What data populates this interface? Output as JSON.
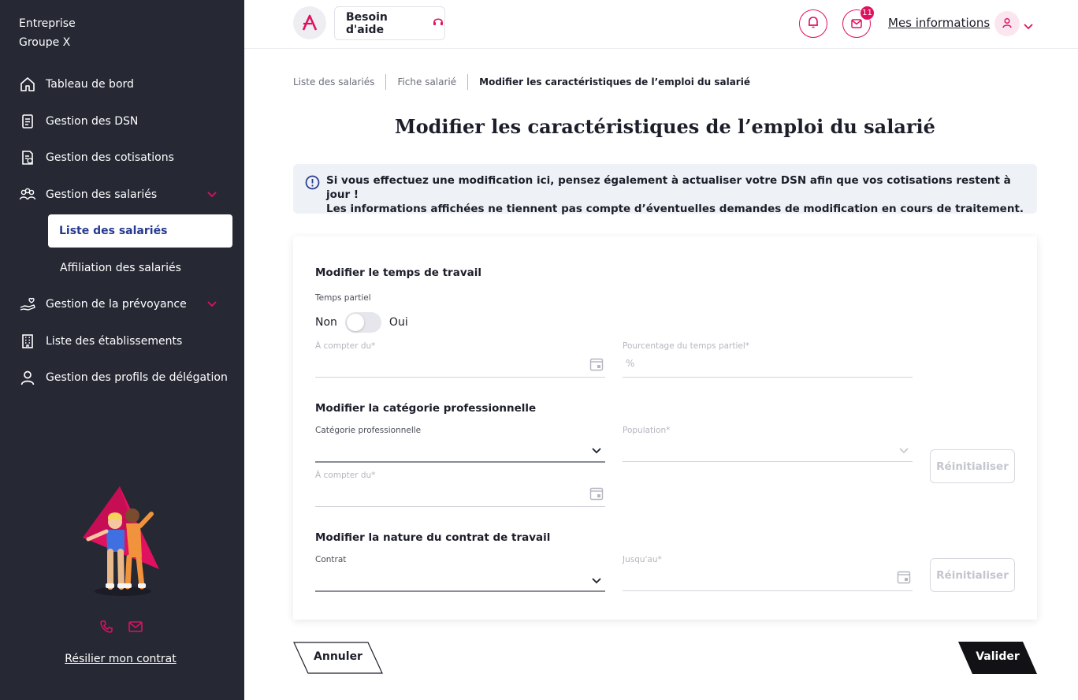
{
  "sidebar": {
    "company_line1": "Entreprise",
    "company_line2": "Groupe X",
    "items": [
      {
        "label": "Tableau de bord",
        "icon": "home-icon"
      },
      {
        "label": "Gestion des DSN",
        "icon": "document-icon"
      },
      {
        "label": "Gestion des cotisations",
        "icon": "invoice-icon"
      },
      {
        "label": "Gestion des salariés",
        "icon": "people-icon"
      },
      {
        "label": "Gestion de la prévoyance",
        "icon": "hand-heart-icon"
      },
      {
        "label": "Liste des établissements",
        "icon": "building-icon"
      },
      {
        "label": "Gestion des profils de délégation",
        "icon": "user-icon"
      }
    ],
    "subitems": [
      {
        "label": "Liste des salariés",
        "active": true
      },
      {
        "label": "Affiliation des salariés",
        "active": false
      }
    ],
    "resilier": "Résilier mon contrat"
  },
  "header": {
    "help_label": "Besoin d'aide",
    "notification_count": "11",
    "account_label": "Mes informations"
  },
  "breadcrumb": {
    "item1": "Liste des salariés",
    "item2": "Fiche salarié",
    "current": "Modifier les caractéristiques de l’emploi du salarié"
  },
  "page": {
    "title": "Modifier les caractéristiques de l’emploi du salarié",
    "info_line1": "Si vous effectuez une modification ici, pensez également à actualiser votre DSN afin que vos cotisations restent à jour !",
    "info_line2": "Les informations affichées ne tiennent pas compte d’éventuelles demandes de modification en cours de traitement."
  },
  "form": {
    "temps": {
      "title": "Modifier le temps de travail",
      "partiel_label": "Temps partiel",
      "no": "Non",
      "yes": "Oui",
      "date_label": "À compter du*",
      "date_value": "",
      "percent_label": "Pourcentage du temps partiel*",
      "percent_symbol": "%",
      "percent_value": ""
    },
    "categorie": {
      "title": "Modifier la catégorie professionnelle",
      "cat_label": "Catégorie professionnelle",
      "cat_value": "",
      "population_label": "Population*",
      "population_value": "",
      "date_label": "À compter du*",
      "date_value": "",
      "reset": "Réinitialiser"
    },
    "contrat": {
      "title": "Modifier la nature du contrat de travail",
      "contrat_label": "Contrat",
      "contrat_value": "",
      "until_label": "Jusqu'au*",
      "until_value": "",
      "reset": "Réinitialiser"
    }
  },
  "footer": {
    "cancel": "Annuler",
    "submit": "Valider"
  },
  "colors": {
    "sidebar_bg": "#262834",
    "accent": "#e0115f",
    "active_text": "#263a8f",
    "info_bg": "#eef1f6"
  }
}
